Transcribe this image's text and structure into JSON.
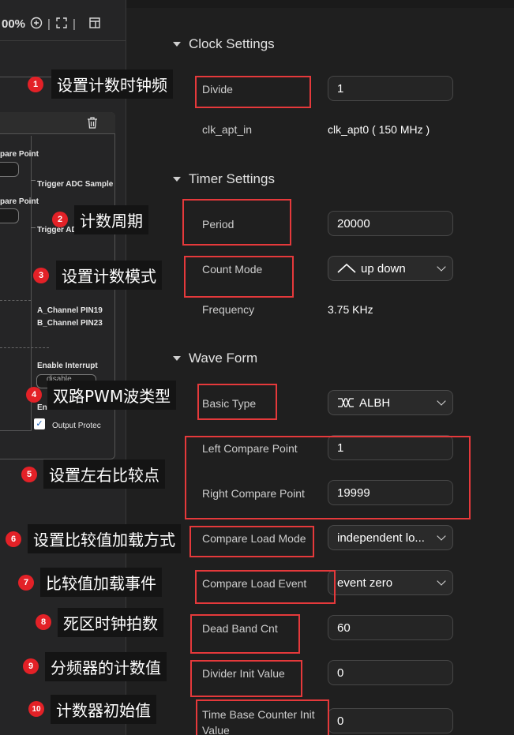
{
  "toolbar": {
    "zoom": "00%",
    "zoom_in_icon": "zoom-in-icon",
    "fullscreen_icon": "fullscreen-icon",
    "panel_icon": "panel-layout-icon"
  },
  "canvas": {
    "compare_point_1": "pare Point",
    "compare_point_2": "pare Point",
    "trigger_adc_1": "Trigger ADC Sample",
    "trigger_adc_2": "Trigger ADC Sample",
    "a_channel": "A_Channel PIN19",
    "b_channel": "B_Channel PIN23",
    "enable_interrupt": "Enable Interrupt",
    "interrupt_select": "disable",
    "enable_protect": "Enable Protect",
    "output_protect": "Output Protec"
  },
  "sections": {
    "clock": "Clock Settings",
    "timer": "Timer Settings",
    "wave": "Wave Form"
  },
  "fields": {
    "divide": {
      "label": "Divide",
      "value": "1"
    },
    "clk_apt_in": {
      "label": "clk_apt_in",
      "value": "clk_apt0 ( 150 MHz )"
    },
    "period": {
      "label": "Period",
      "value": "20000"
    },
    "count_mode": {
      "label": "Count Mode",
      "value": "up down"
    },
    "frequency": {
      "label": "Frequency",
      "value": "3.75 KHz"
    },
    "basic_type": {
      "label": "Basic Type",
      "value": "ALBH"
    },
    "left_compare": {
      "label": "Left Compare Point",
      "value": "1"
    },
    "right_compare": {
      "label": "Right Compare Point",
      "value": "19999"
    },
    "compare_load_mode": {
      "label": "Compare Load Mode",
      "value": "independent lo..."
    },
    "compare_load_event": {
      "label": "Compare Load Event",
      "value": "event zero"
    },
    "dead_band_cnt": {
      "label": "Dead Band Cnt",
      "value": "60"
    },
    "divider_init": {
      "label": "Divider Init Value",
      "value": "0"
    },
    "tb_counter_init": {
      "label": "Time Base Counter Init Value",
      "value": "0"
    }
  },
  "annotations": [
    {
      "num": "1",
      "text": "设置计数时钟频"
    },
    {
      "num": "2",
      "text": "计数周期"
    },
    {
      "num": "3",
      "text": "设置计数模式"
    },
    {
      "num": "4",
      "text": "双路PWM波类型"
    },
    {
      "num": "5",
      "text": "设置左右比较点"
    },
    {
      "num": "6",
      "text": "设置比较值加载方式"
    },
    {
      "num": "7",
      "text": "比较值加载事件"
    },
    {
      "num": "8",
      "text": "死区时钟拍数"
    },
    {
      "num": "9",
      "text": "分频器的计数值"
    },
    {
      "num": "10",
      "text": "计数器初始值"
    }
  ],
  "colors": {
    "annotation_red": "#e5393b",
    "badge_red": "#e32127",
    "background": "#1f1f1f"
  }
}
